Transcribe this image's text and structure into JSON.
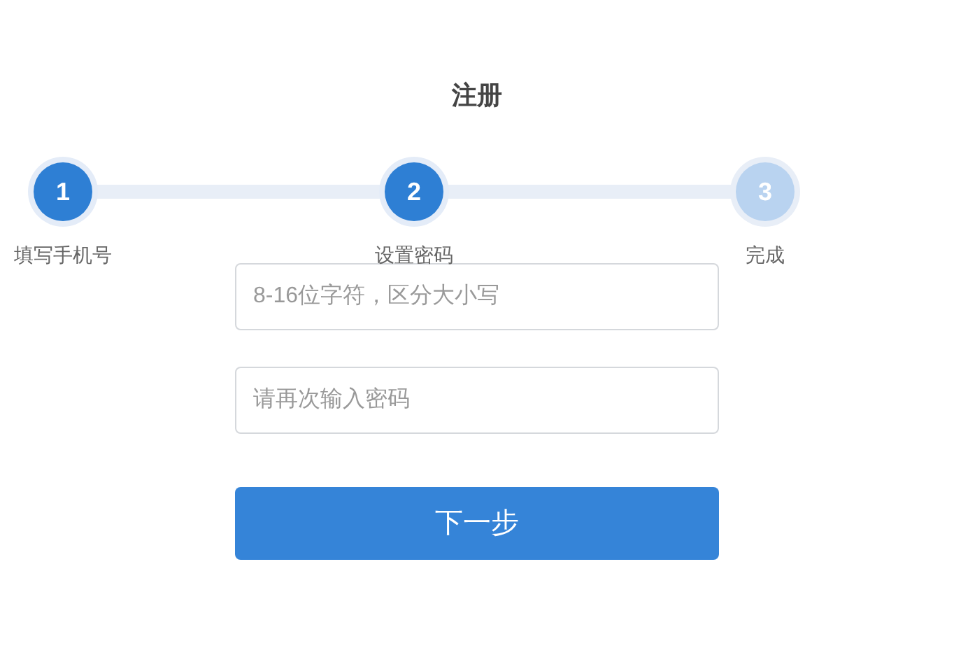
{
  "title": "注册",
  "steps": [
    {
      "number": "1",
      "label": "填写手机号",
      "completed": true
    },
    {
      "number": "2",
      "label": "设置密码",
      "completed": true
    },
    {
      "number": "3",
      "label": "完成",
      "completed": false
    }
  ],
  "fields": [
    {
      "placeholder": "8-16位字符，区分大小写"
    },
    {
      "placeholder": "请再次输入密码"
    }
  ],
  "button": {
    "label": "下一步"
  }
}
